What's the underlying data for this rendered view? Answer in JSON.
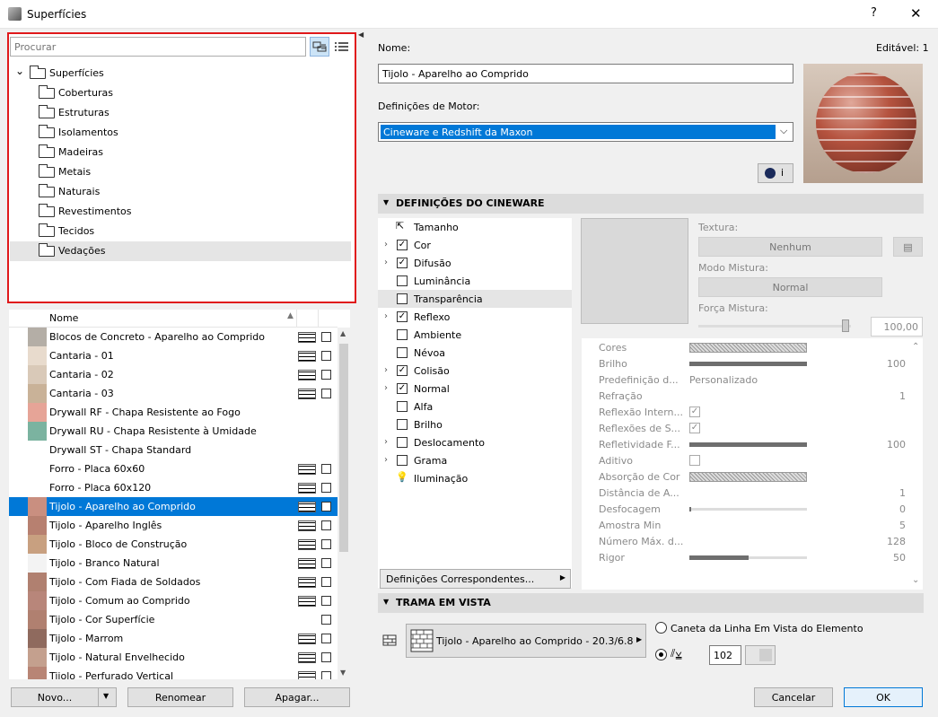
{
  "window": {
    "title": "Superfícies",
    "help": "?",
    "close": "✕"
  },
  "tree": {
    "search_placeholder": "Procurar",
    "root": "Superfícies",
    "folders": [
      "Coberturas",
      "Estruturas",
      "Isolamentos",
      "Madeiras",
      "Metais",
      "Naturais",
      "Revestimentos",
      "Tecidos",
      "Vedações"
    ],
    "selected": "Vedações"
  },
  "list": {
    "header": "Nome",
    "sort_icon": "sort-asc-icon",
    "items": [
      {
        "name": "Blocos de Concreto - Aparelho ao Comprido",
        "color": "#b4aea6",
        "pattern": true,
        "image": true
      },
      {
        "name": "Cantaria - 01",
        "color": "#e8dbcd",
        "pattern": true,
        "image": true
      },
      {
        "name": "Cantaria - 02",
        "color": "#d9c9b8",
        "pattern": true,
        "image": true
      },
      {
        "name": "Cantaria - 03",
        "color": "#c9b298",
        "pattern": true,
        "image": true
      },
      {
        "name": "Drywall RF - Chapa Resistente ao Fogo",
        "color": "#e6a497",
        "pattern": false,
        "image": false
      },
      {
        "name": "Drywall RU - Chapa Resistente à Umidade",
        "color": "#7bb3a0",
        "pattern": false,
        "image": false
      },
      {
        "name": "Drywall ST - Chapa Standard",
        "color": "#ffffff",
        "pattern": false,
        "image": false
      },
      {
        "name": "Forro - Placa 60x60",
        "color": "#ffffff",
        "pattern": true,
        "image": true
      },
      {
        "name": "Forro - Placa 60x120",
        "color": "#ffffff",
        "pattern": true,
        "image": true
      },
      {
        "name": "Tijolo - Aparelho ao Comprido",
        "color": "#c98f80",
        "pattern": true,
        "image": true
      },
      {
        "name": "Tijolo - Aparelho Inglês",
        "color": "#b78070",
        "pattern": true,
        "image": true
      },
      {
        "name": "Tijolo - Bloco de Construção",
        "color": "#c8a080",
        "pattern": true,
        "image": true
      },
      {
        "name": "Tijolo - Branco Natural",
        "color": "#f3f3f3",
        "pattern": true,
        "image": true
      },
      {
        "name": "Tijolo - Com Fiada de Soldados",
        "color": "#b08070",
        "pattern": true,
        "image": true
      },
      {
        "name": "Tijolo - Comum ao Comprido",
        "color": "#b8867a",
        "pattern": true,
        "image": true
      },
      {
        "name": "Tijolo - Cor Superfície",
        "color": "#b08070",
        "pattern": false,
        "image": true
      },
      {
        "name": "Tijolo - Marrom",
        "color": "#8f6a5e",
        "pattern": true,
        "image": true
      },
      {
        "name": "Tijolo - Natural Envelhecido",
        "color": "#c4a08e",
        "pattern": true,
        "image": true
      },
      {
        "name": "Tijolo - Perfurado Vertical",
        "color": "#b88575",
        "pattern": true,
        "image": true
      }
    ],
    "selected_index": 9
  },
  "buttons": {
    "new": "Novo...",
    "rename": "Renomear",
    "delete": "Apagar...",
    "cancel": "Cancelar",
    "ok": "OK"
  },
  "right": {
    "name_label": "Nome:",
    "editable": "Editável: 1",
    "name_value": "Tijolo - Aparelho ao Comprido",
    "engine_label": "Definições de Motor:",
    "engine_value": "Cineware e Redshift da Maxon",
    "info_btn": "i"
  },
  "cineware": {
    "title": "DEFINIÇÕES DO CINEWARE",
    "channels": [
      {
        "label": "Tamanho",
        "type": "icon",
        "chev": false
      },
      {
        "label": "Cor",
        "type": "check",
        "checked": true,
        "chev": true
      },
      {
        "label": "Difusão",
        "type": "check",
        "checked": true,
        "chev": true
      },
      {
        "label": "Luminância",
        "type": "check",
        "checked": false,
        "chev": false
      },
      {
        "label": "Transparência",
        "type": "check",
        "checked": false,
        "chev": false
      },
      {
        "label": "Reflexo",
        "type": "check",
        "checked": true,
        "chev": true
      },
      {
        "label": "Ambiente",
        "type": "check",
        "checked": false,
        "chev": false
      },
      {
        "label": "Névoa",
        "type": "check",
        "checked": false,
        "chev": false
      },
      {
        "label": "Colisão",
        "type": "check",
        "checked": true,
        "chev": true
      },
      {
        "label": "Normal",
        "type": "check",
        "checked": true,
        "chev": true
      },
      {
        "label": "Alfa",
        "type": "check",
        "checked": false,
        "chev": false
      },
      {
        "label": "Brilho",
        "type": "check",
        "checked": false,
        "chev": false
      },
      {
        "label": "Deslocamento",
        "type": "check",
        "checked": false,
        "chev": true
      },
      {
        "label": "Grama",
        "type": "check",
        "checked": false,
        "chev": true
      },
      {
        "label": "Iluminação",
        "type": "icon",
        "chev": false
      }
    ],
    "selected_index": 4,
    "texture_label": "Textura:",
    "texture_value": "Nenhum",
    "mix_mode_label": "Modo Mistura:",
    "mix_mode_value": "Normal",
    "mix_strength_label": "Força Mistura:",
    "mix_strength_value": "100,00",
    "mix_strength_fraction": 1.0,
    "match_btn": "Definições Correspondentes...",
    "properties": [
      {
        "label": "Cores",
        "kind": "hatch"
      },
      {
        "label": "Brilho",
        "kind": "bar",
        "value": "100",
        "fraction": 1.0
      },
      {
        "label": "Predefinição d...",
        "kind": "text",
        "value": "Personalizado"
      },
      {
        "label": "Refração",
        "kind": "num",
        "value": "1"
      },
      {
        "label": "Reflexão Intern...",
        "kind": "check",
        "checked": true
      },
      {
        "label": "Reflexões de S...",
        "kind": "check",
        "checked": true
      },
      {
        "label": "Refletividade F...",
        "kind": "bar",
        "value": "100",
        "fraction": 1.0
      },
      {
        "label": "Aditivo",
        "kind": "check",
        "checked": false
      },
      {
        "label": "Absorção de Cor",
        "kind": "hatch"
      },
      {
        "label": "Distância de A...",
        "kind": "num",
        "value": "1"
      },
      {
        "label": "Desfocagem",
        "kind": "bar",
        "value": "0",
        "fraction": 0.0
      },
      {
        "label": "Amostra Min",
        "kind": "num",
        "value": "5"
      },
      {
        "label": "Número Máx. d...",
        "kind": "num",
        "value": "128"
      },
      {
        "label": "Rigor",
        "kind": "bar",
        "value": "50",
        "fraction": 0.5
      }
    ]
  },
  "trama": {
    "title": "TRAMA EM VISTA",
    "pattern_name": "Tijolo - Aparelho ao Comprido - 20.3/6.8",
    "radio_label": "Caneta da Linha Em Vista do Elemento",
    "pen_value": "102"
  }
}
